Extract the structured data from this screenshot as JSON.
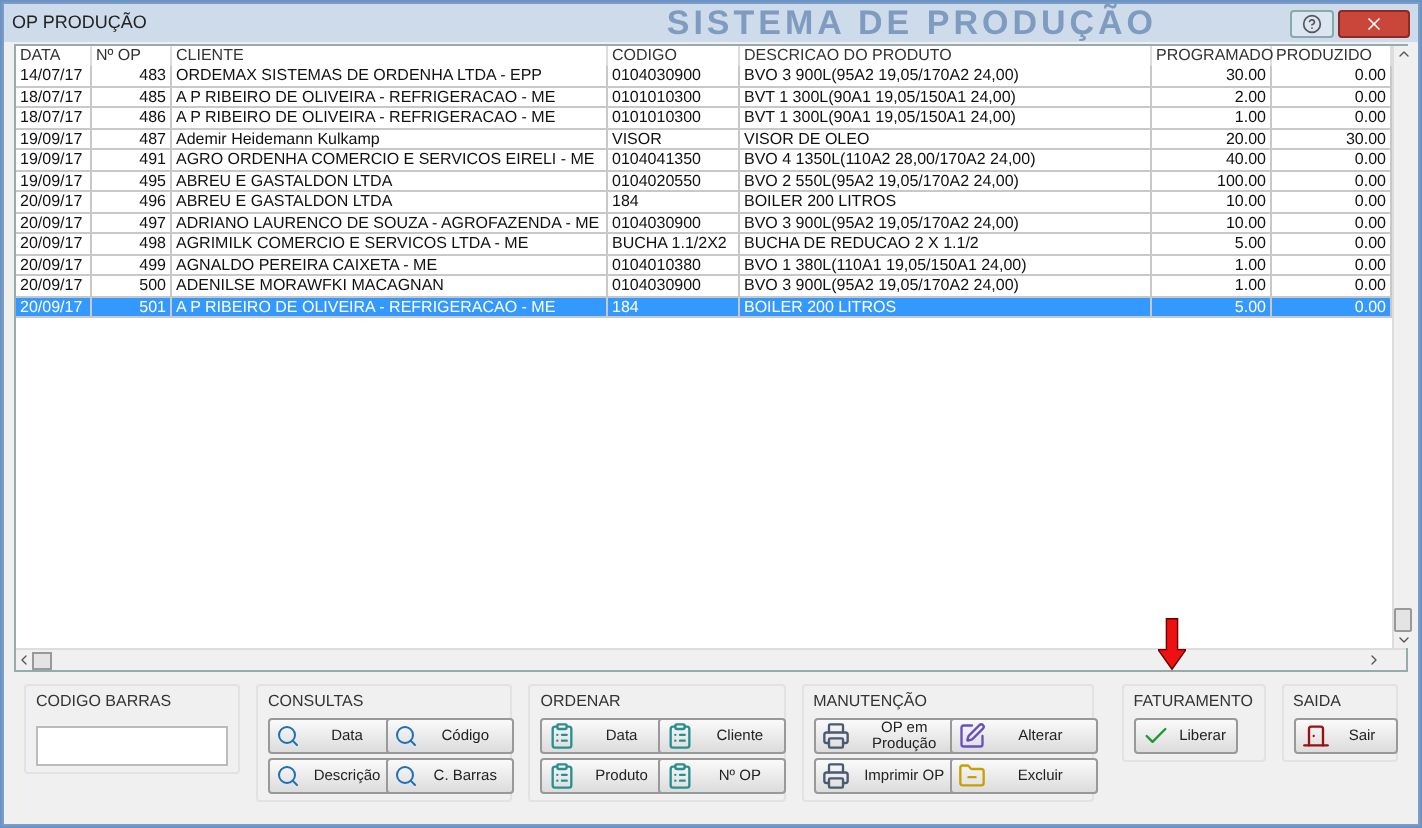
{
  "window": {
    "title": "OP PRODUÇÃO",
    "banner": "SISTEMA DE PRODUÇÃO"
  },
  "table": {
    "columns": [
      "DATA",
      "Nº OP",
      "CLIENTE",
      "CODIGO",
      "DESCRICAO DO PRODUTO",
      "PROGRAMADO",
      "PRODUZIDO"
    ],
    "rows": [
      {
        "cells": [
          "14/07/17",
          "483",
          "ORDEMAX SISTEMAS DE ORDENHA LTDA - EPP",
          "0104030900",
          "BVO 3 900L(95A2 19,05/170A2 24,00)",
          "30.00",
          "0.00"
        ],
        "selected": false
      },
      {
        "cells": [
          "18/07/17",
          "485",
          "A P RIBEIRO DE OLIVEIRA - REFRIGERACAO - ME",
          "0101010300",
          "BVT 1 300L(90A1 19,05/150A1 24,00)",
          "2.00",
          "0.00"
        ],
        "selected": false
      },
      {
        "cells": [
          "18/07/17",
          "486",
          "A P RIBEIRO DE OLIVEIRA - REFRIGERACAO - ME",
          "0101010300",
          "BVT 1 300L(90A1 19,05/150A1 24,00)",
          "1.00",
          "0.00"
        ],
        "selected": false
      },
      {
        "cells": [
          "19/09/17",
          "487",
          "Ademir Heidemann Kulkamp",
          "VISOR",
          "VISOR DE OLEO",
          "20.00",
          "30.00"
        ],
        "selected": false
      },
      {
        "cells": [
          "19/09/17",
          "491",
          "AGRO ORDENHA COMERCIO E SERVICOS EIRELI  - ME",
          "0104041350",
          "BVO 4 1350L(110A2 28,00/170A2 24,00)",
          "40.00",
          "0.00"
        ],
        "selected": false
      },
      {
        "cells": [
          "19/09/17",
          "495",
          "ABREU E GASTALDON LTDA",
          "0104020550",
          "BVO 2 550L(95A2 19,05/170A2 24,00)",
          "100.00",
          "0.00"
        ],
        "selected": false
      },
      {
        "cells": [
          "20/09/17",
          "496",
          "ABREU E GASTALDON LTDA",
          "184",
          "BOILER 200 LITROS",
          "10.00",
          "0.00"
        ],
        "selected": false
      },
      {
        "cells": [
          "20/09/17",
          "497",
          "ADRIANO LAURENCO DE SOUZA - AGROFAZENDA - ME",
          "0104030900",
          "BVO 3 900L(95A2 19,05/170A2 24,00)",
          "10.00",
          "0.00"
        ],
        "selected": false
      },
      {
        "cells": [
          "20/09/17",
          "498",
          "AGRIMILK COMERCIO E SERVICOS LTDA - ME",
          "BUCHA 1.1/2X2",
          "BUCHA DE REDUCAO 2 X 1.1/2",
          "5.00",
          "0.00"
        ],
        "selected": false
      },
      {
        "cells": [
          "20/09/17",
          "499",
          "AGNALDO PEREIRA CAIXETA - ME",
          "0104010380",
          "BVO 1 380L(110A1 19,05/150A1 24,00)",
          "1.00",
          "0.00"
        ],
        "selected": false
      },
      {
        "cells": [
          "20/09/17",
          "500",
          "ADENILSE MORAWFKI MACAGNAN",
          "0104030900",
          "BVO 3 900L(95A2 19,05/170A2 24,00)",
          "1.00",
          "0.00"
        ],
        "selected": false
      },
      {
        "cells": [
          "20/09/17",
          "501",
          "A P RIBEIRO DE OLIVEIRA - REFRIGERACAO - ME",
          "184",
          "BOILER 200 LITROS",
          "5.00",
          "0.00"
        ],
        "selected": true
      }
    ]
  },
  "groups": [
    {
      "title": "CODIGO BARRAS",
      "kind": "field"
    },
    {
      "title": "CONSULTAS",
      "kind": "buttons",
      "buttons": [
        "Data",
        "Código",
        "Descrição",
        "C. Barras"
      ]
    },
    {
      "title": "ORDENAR",
      "kind": "buttons",
      "buttons": [
        "Data",
        "Cliente",
        "Produto",
        "Nº OP"
      ]
    },
    {
      "title": "MANUTENÇÃO",
      "kind": "buttons",
      "buttons": [
        "OP em Produção",
        "Alterar",
        "Imprimir OP",
        "Excluir"
      ]
    },
    {
      "title": "FATURAMENTO",
      "kind": "buttons",
      "buttons": [
        "Liberar"
      ]
    },
    {
      "title": "SAIDA",
      "kind": "buttons",
      "buttons": [
        "Sair"
      ]
    }
  ]
}
